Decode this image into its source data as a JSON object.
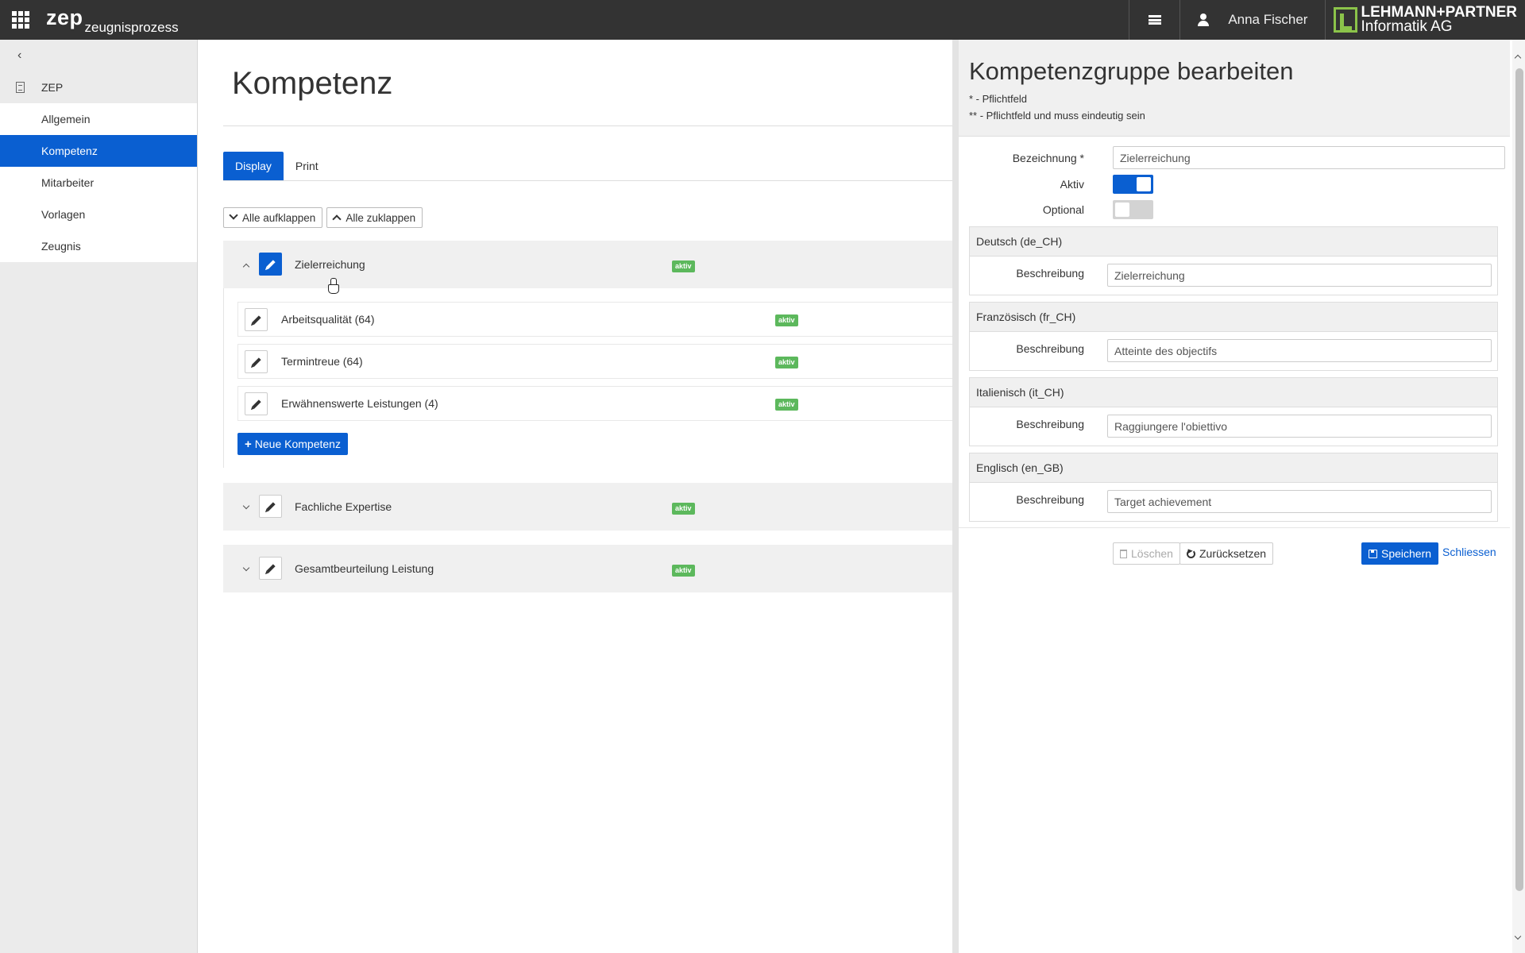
{
  "topbar": {
    "app_name": "zep",
    "app_sub": "zeugnisprozess",
    "user_name": "Anna Fischer",
    "logo_line1": "LEHMANN+PARTNER",
    "logo_line2": "Informatik AG"
  },
  "sidebar": {
    "root": "ZEP",
    "items": [
      {
        "label": "Allgemein"
      },
      {
        "label": "Kompetenz"
      },
      {
        "label": "Mitarbeiter"
      },
      {
        "label": "Vorlagen"
      },
      {
        "label": "Zeugnis"
      }
    ],
    "active_index": 1
  },
  "main": {
    "title": "Kompetenz",
    "tabs": [
      {
        "label": "Display"
      },
      {
        "label": "Print"
      }
    ],
    "expand_all": "Alle aufklappen",
    "collapse_all": "Alle zuklappen",
    "groups": [
      {
        "label": "Zielerreichung",
        "badge": "aktiv",
        "expanded": true,
        "items": [
          {
            "label": "Arbeitsqualität (64)",
            "badge": "aktiv"
          },
          {
            "label": "Termintreue (64)",
            "badge": "aktiv"
          },
          {
            "label": "Erwähnenswerte Leistungen (4)",
            "badge": "aktiv"
          }
        ],
        "new_button": "Neue Kompetenz"
      },
      {
        "label": "Fachliche Expertise",
        "badge": "aktiv",
        "expanded": false
      },
      {
        "label": "Gesamtbeurteilung Leistung",
        "badge": "aktiv",
        "expanded": false
      }
    ]
  },
  "panel": {
    "title": "Kompetenzgruppe bearbeiten",
    "note1": "* - Pflichtfeld",
    "note2": "** - Pflichtfeld und muss eindeutig sein",
    "bezeichnung_label": "Bezeichnung *",
    "bezeichnung_value": "Zielerreichung",
    "aktiv_label": "Aktiv",
    "aktiv_on": true,
    "optional_label": "Optional",
    "optional_on": false,
    "languages": [
      {
        "head": "Deutsch (de_CH)",
        "label": "Beschreibung",
        "value": "Zielerreichung"
      },
      {
        "head": "Französisch (fr_CH)",
        "label": "Beschreibung",
        "value": "Atteinte des objectifs"
      },
      {
        "head": "Italienisch (it_CH)",
        "label": "Beschreibung",
        "value": "Raggiungere l'obiettivo"
      },
      {
        "head": "Englisch (en_GB)",
        "label": "Beschreibung",
        "value": "Target achievement"
      }
    ],
    "delete_label": "Löschen",
    "reset_label": "Zurücksetzen",
    "save_label": "Speichern",
    "close_label": "Schliessen"
  },
  "colors": {
    "primary": "#0a5fd1",
    "topbar": "#333333",
    "badge": "#5cb85c",
    "logo_green": "#8bc34a"
  }
}
